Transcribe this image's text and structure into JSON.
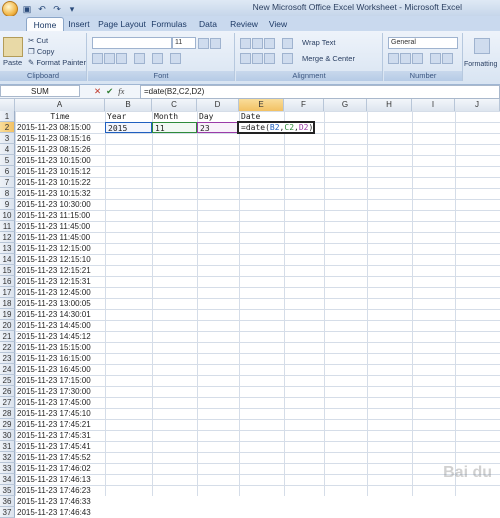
{
  "window": {
    "title": "New Microsoft Office Excel Worksheet - Microsoft Excel"
  },
  "ribbon_tabs": [
    "Home",
    "Insert",
    "Page Layout",
    "Formulas",
    "Data",
    "Review",
    "View"
  ],
  "ribbon": {
    "clipboard": {
      "label": "Clipboard",
      "paste": "Paste",
      "cut": "Cut",
      "copy": "Copy",
      "format_painter": "Format Painter"
    },
    "font": {
      "label": "Font",
      "size": "11"
    },
    "alignment": {
      "label": "Alignment",
      "wrap_text": "Wrap Text",
      "merge_center": "Merge & Center"
    },
    "number": {
      "label": "Number",
      "format": "General"
    },
    "styles": {
      "conditional_formatting": "Formatting"
    }
  },
  "formula_bar": {
    "name_box": "SUM",
    "fx": "fx",
    "formula": "=date(B2,C2,D2)"
  },
  "columns": [
    "A",
    "B",
    "C",
    "D",
    "E",
    "F",
    "G",
    "H",
    "I",
    "J"
  ],
  "rows": [
    "1",
    "2",
    "3",
    "4",
    "5",
    "6",
    "7",
    "8",
    "9",
    "10",
    "11",
    "12",
    "13",
    "14",
    "15",
    "16",
    "17",
    "18",
    "19",
    "20",
    "21",
    "22",
    "23",
    "24",
    "25",
    "26",
    "27",
    "28",
    "29",
    "30",
    "31",
    "32",
    "33",
    "34",
    "35",
    "36",
    "37"
  ],
  "headers": {
    "a": "Time",
    "b": "Year",
    "c": "Month",
    "d": "Day",
    "e": "Date"
  },
  "row2": {
    "b": "2015",
    "c": "11",
    "d": "23",
    "e_prefix": "=date(",
    "e_b": "B2",
    "e_sep1": ",",
    "e_c": "C2",
    "e_sep2": ",",
    "e_d": "D2",
    "e_suffix": ")"
  },
  "times": [
    "2015-11-23 08:15:00",
    "2015-11-23 08:15:16",
    "2015-11-23 08:15:26",
    "2015-11-23 10:15:00",
    "2015-11-23 10:15:12",
    "2015-11-23 10:15:22",
    "2015-11-23 10:15:32",
    "2015-11-23 10:30:00",
    "2015-11-23 11:15:00",
    "2015-11-23 11:45:00",
    "2015-11-23 11:45:00",
    "2015-11-23 12:15:00",
    "2015-11-23 12:15:10",
    "2015-11-23 12:15:21",
    "2015-11-23 12:15:31",
    "2015-11-23 12:45:00",
    "2015-11-23 13:00:05",
    "2015-11-23 14:30:01",
    "2015-11-23 14:45:00",
    "2015-11-23 14:45:12",
    "2015-11-23 15:15:00",
    "2015-11-23 16:15:00",
    "2015-11-23 16:45:00",
    "2015-11-23 17:15:00",
    "2015-11-23 17:30:00",
    "2015-11-23 17:45:00",
    "2015-11-23 17:45:10",
    "2015-11-23 17:45:21",
    "2015-11-23 17:45:31",
    "2015-11-23 17:45:41",
    "2015-11-23 17:45:52",
    "2015-11-23 17:46:02",
    "2015-11-23 17:46:13",
    "2015-11-23 17:46:23",
    "2015-11-23 17:46:33",
    "2015-11-23 17:46:43"
  ],
  "active": {
    "column": "E",
    "row": "2"
  }
}
